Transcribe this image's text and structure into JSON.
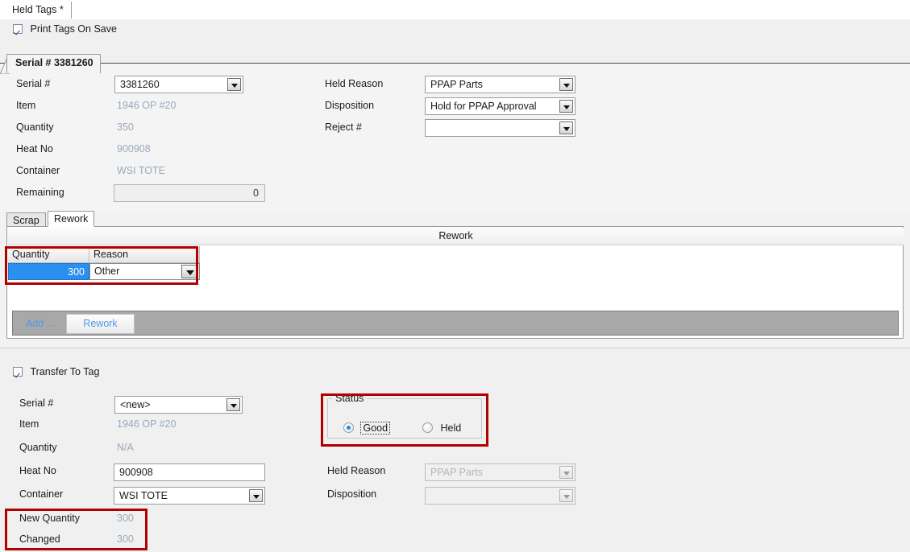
{
  "window": {
    "document_tab": "Held Tags *"
  },
  "print_option": {
    "label": "Print Tags On Save",
    "checked": true
  },
  "serial_tab": {
    "title": "Serial # 3381260"
  },
  "held_tag_form": {
    "left_fields": [
      {
        "label": "Serial #",
        "value": "3381260",
        "type": "combo"
      },
      {
        "label": "Item",
        "value": "1946 OP #20",
        "type": "readonly"
      },
      {
        "label": "Quantity",
        "value": "350",
        "type": "readonly"
      },
      {
        "label": "Heat No",
        "value": "900908",
        "type": "readonly"
      },
      {
        "label": "Container",
        "value": "WSI TOTE",
        "type": "readonly"
      },
      {
        "label": "Remaining",
        "value": "0",
        "type": "readonly-box"
      }
    ],
    "right_fields": [
      {
        "label": "Held Reason",
        "value": "PPAP Parts",
        "type": "combo"
      },
      {
        "label": "Disposition",
        "value": "Hold for PPAP Approval",
        "type": "combo"
      },
      {
        "label": "Reject #",
        "value": "",
        "type": "combo"
      }
    ]
  },
  "inner_tabs": {
    "items": [
      {
        "label": "Scrap",
        "active": false
      },
      {
        "label": "Rework",
        "active": true
      }
    ]
  },
  "rework_panel": {
    "title": "Rework",
    "grid": {
      "columns": [
        "Quantity",
        "Reason"
      ],
      "sort_glyph": "/",
      "rows": [
        {
          "quantity": "300",
          "reason": "Other",
          "selected": true
        }
      ]
    },
    "actions": {
      "add_label": "Add ...",
      "rework_label": "Rework"
    }
  },
  "transfer": {
    "checkbox_label": "Transfer To Tag",
    "checked": true,
    "left_fields": [
      {
        "label": "Serial #",
        "value": "<new>",
        "type": "combo"
      },
      {
        "label": "Item",
        "value": "1946 OP #20",
        "type": "readonly"
      },
      {
        "label": "Quantity",
        "value": "N/A",
        "type": "readonly"
      },
      {
        "label": "Heat No",
        "value": "900908",
        "type": "text"
      },
      {
        "label": "Container",
        "value": "WSI TOTE",
        "type": "combo"
      },
      {
        "label": "New Quantity",
        "value": "300",
        "type": "readonly"
      },
      {
        "label": "Changed",
        "value": "300",
        "type": "readonly"
      }
    ],
    "status": {
      "legend": "Status",
      "options": [
        {
          "label": "Good",
          "selected": true,
          "focused": true
        },
        {
          "label": "Held",
          "selected": false,
          "focused": false
        }
      ]
    },
    "right_fields": [
      {
        "label": "Held Reason",
        "value": "PPAP Parts",
        "type": "combo",
        "disabled": true
      },
      {
        "label": "Disposition",
        "value": "",
        "type": "combo",
        "disabled": true
      }
    ]
  },
  "colors": {
    "highlight_box": "#b00000",
    "selection": "#2a8fee",
    "link": "#4d9ae8",
    "readonly_text": "#9aa8bd"
  }
}
